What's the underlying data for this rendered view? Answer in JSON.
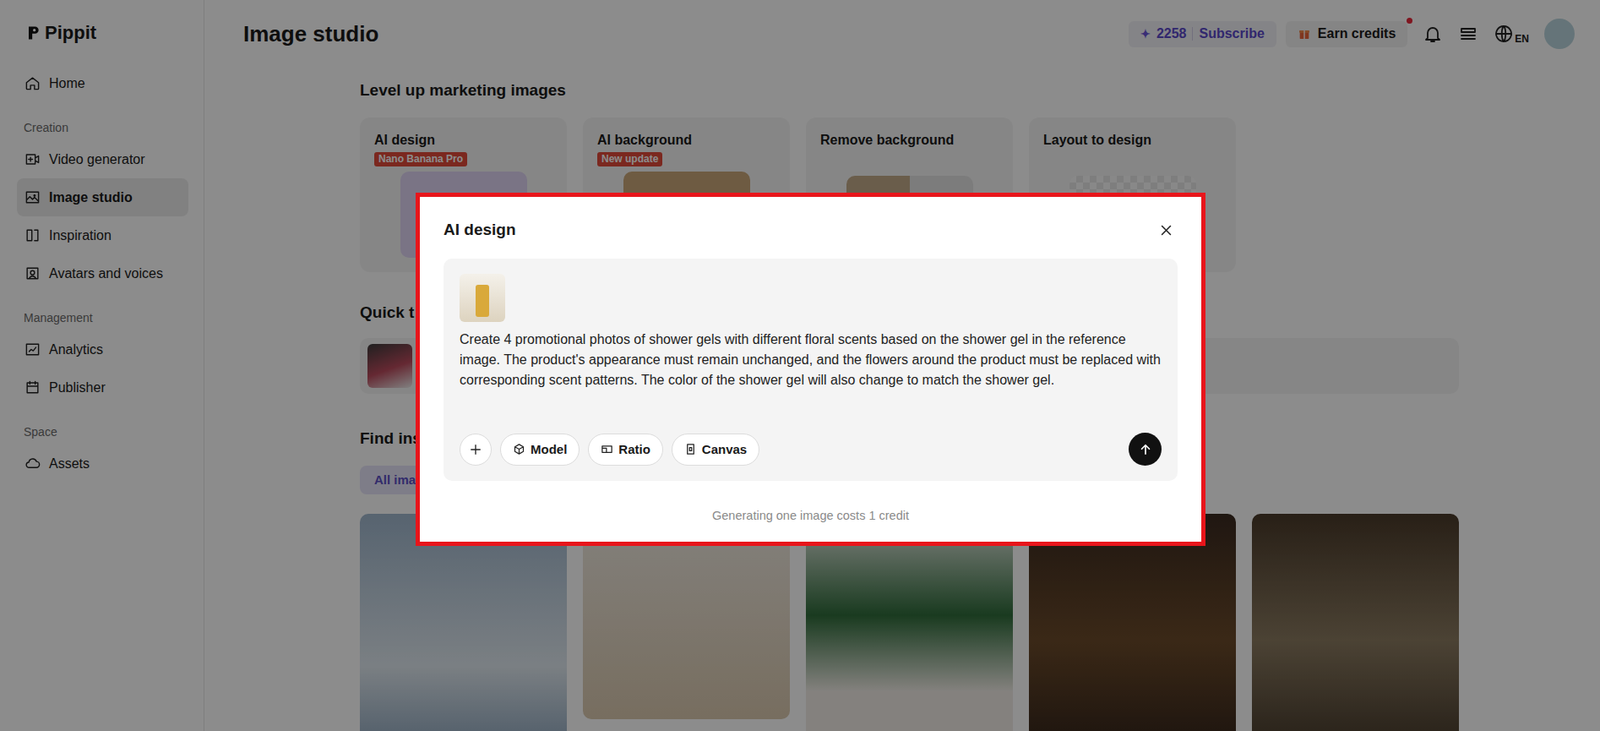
{
  "sidebar": {
    "logo": "Pippit",
    "top_items": [
      {
        "label": "Home",
        "selected": false
      }
    ],
    "sections": [
      {
        "title": "Creation",
        "items": [
          {
            "label": "Video generator",
            "selected": false
          },
          {
            "label": "Image studio",
            "selected": true
          },
          {
            "label": "Inspiration",
            "selected": false
          },
          {
            "label": "Avatars and voices",
            "selected": false
          }
        ]
      },
      {
        "title": "Management",
        "items": [
          {
            "label": "Analytics",
            "selected": false
          },
          {
            "label": "Publisher",
            "selected": false
          }
        ]
      },
      {
        "title": "Space",
        "items": [
          {
            "label": "Assets",
            "selected": false
          }
        ]
      }
    ]
  },
  "header": {
    "title": "Image studio",
    "credit_icon": "✦",
    "credits": "2258",
    "subscribe": "Subscribe",
    "earn_credits": "Earn credits",
    "earn_credits_dot": true,
    "language": "EN"
  },
  "level_up": {
    "title": "Level up marketing images",
    "cards": [
      {
        "title": "AI design",
        "badge": "Nano Banana Pro"
      },
      {
        "title": "AI background",
        "badge": "New update"
      },
      {
        "title": "Remove background"
      },
      {
        "title": "Layout to design"
      }
    ]
  },
  "quick_tools": {
    "title": "Quick t"
  },
  "inspiration": {
    "title": "Find ins",
    "filters": [
      {
        "label": "All ima",
        "selected": true
      }
    ]
  },
  "modal": {
    "title": "AI design",
    "prompt": "Create 4 promotional photos of shower gels with different floral scents based on the shower gel in the reference image. The product's appearance must remain unchanged, and the flowers around the product must be replaced with corresponding scent patterns. The color of the shower gel will also change to match the shower gel.",
    "tools": [
      "Model",
      "Ratio",
      "Canvas"
    ],
    "footer": "Generating one image costs 1 credit"
  }
}
